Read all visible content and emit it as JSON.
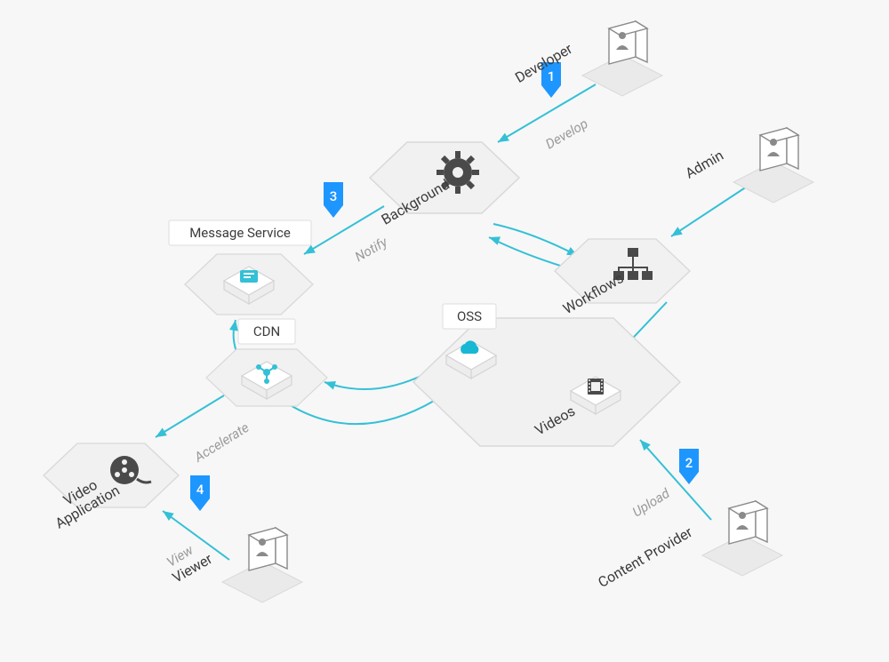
{
  "nodes": {
    "developer": {
      "label": "Developer"
    },
    "admin": {
      "label": "Admin"
    },
    "content_provider": {
      "label": "Content Provider"
    },
    "viewer": {
      "label": "Viewer"
    },
    "background": {
      "label": "Background"
    },
    "workflows": {
      "label": "Workflows"
    },
    "message_service": {
      "label": "Message Service"
    },
    "cdn": {
      "label": "CDN"
    },
    "oss": {
      "label": "OSS"
    },
    "videos": {
      "label": "Videos"
    },
    "video_app": {
      "label_line1": "Video",
      "label_line2": "Application"
    }
  },
  "edges": {
    "develop": {
      "label": "Develop"
    },
    "notify": {
      "label": "Notify"
    },
    "upload": {
      "label": "Upload"
    },
    "accelerate": {
      "label": "Accelerate"
    },
    "view": {
      "label": "View"
    }
  },
  "steps": {
    "s1": "1",
    "s2": "2",
    "s3": "3",
    "s4": "4"
  },
  "colors": {
    "accent": "#34c0d6",
    "marker": "#1e96ff"
  }
}
